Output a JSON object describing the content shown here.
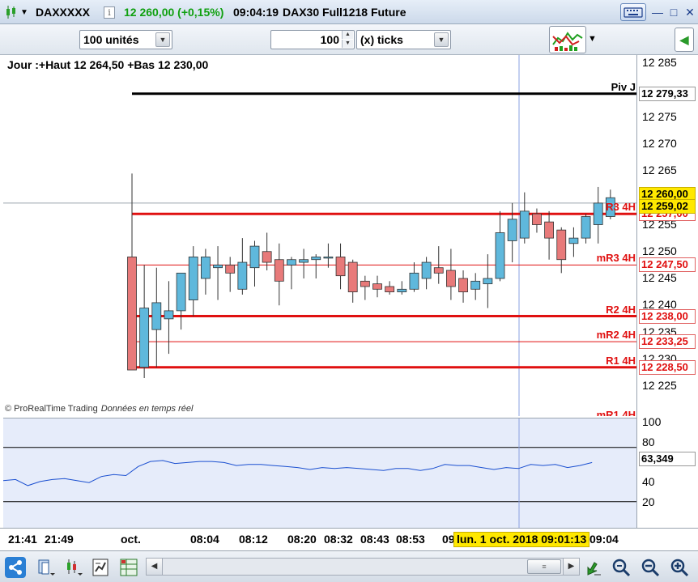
{
  "window": {
    "symbol": "DAXXXXX",
    "price_change": "12 260,00 (+0,15%)",
    "time": "09:04:19",
    "instrument": "DAX30 Full1218 Future",
    "info_icon": "info-icon",
    "keyboard_icon": "keyboard-icon",
    "minimize_icon": "minimize-icon",
    "maximize_icon": "maximize-icon",
    "close_icon": "close-icon"
  },
  "toolbar": {
    "units_select": "100 unités",
    "ticks_value": "100",
    "ticks_unit": "(x) ticks",
    "indicator_icon": "chart-indicators-icon"
  },
  "chart": {
    "header": "Jour :+Haut 12 264,50 +Bas 12 230,00",
    "copyright": "© ProRealTime Trading",
    "realtime": "Données en temps réel",
    "price_ticks": [
      "12 285",
      "12 275",
      "12 270",
      "12 265",
      "12 255",
      "12 250",
      "12 245",
      "12 240",
      "12 235",
      "12 230",
      "12 225"
    ],
    "levels": [
      {
        "name": "Piv J",
        "value": "12 279,33",
        "color": "#000000"
      },
      {
        "name": "R3 4H",
        "value": "12 257,00",
        "color": "#e01010"
      },
      {
        "name": "mR3 4H",
        "value": "12 247,50",
        "color": "#e01010"
      },
      {
        "name": "R2 4H",
        "value": "12 238,00",
        "color": "#e01010"
      },
      {
        "name": "mR2 4H",
        "value": "12 233,25",
        "color": "#e01010"
      },
      {
        "name": "R1 4H",
        "value": "12 228,50",
        "color": "#e01010"
      },
      {
        "name": "mR1 4H",
        "value": "",
        "color": "#e01010"
      }
    ],
    "last_price": "12 260,00",
    "cursor_price": "12 259,02",
    "cursor_time": "lun. 1 oct. 2018 09:01:13"
  },
  "chart_data": {
    "type": "candlestick",
    "candles": [
      {
        "o": 12249.0,
        "h": 12264.5,
        "l": 12230.0,
        "c": 12228.0
      },
      {
        "o": 12228.5,
        "h": 12247.5,
        "l": 12226.5,
        "c": 12239.5
      },
      {
        "o": 12235.5,
        "h": 12247.0,
        "l": 12228.5,
        "c": 12240.5
      },
      {
        "o": 12237.5,
        "h": 12244.5,
        "l": 12231.0,
        "c": 12239.0
      },
      {
        "o": 12239.0,
        "h": 12245.5,
        "l": 12235.5,
        "c": 12246.0
      },
      {
        "o": 12241.0,
        "h": 12251.0,
        "l": 12238.0,
        "c": 12249.0
      },
      {
        "o": 12245.0,
        "h": 12250.5,
        "l": 12242.0,
        "c": 12249.0
      },
      {
        "o": 12247.0,
        "h": 12251.0,
        "l": 12241.0,
        "c": 12247.5
      },
      {
        "o": 12247.5,
        "h": 12249.0,
        "l": 12242.5,
        "c": 12246.0
      },
      {
        "o": 12243.0,
        "h": 12252.5,
        "l": 12242.0,
        "c": 12248.0
      },
      {
        "o": 12247.0,
        "h": 12252.0,
        "l": 12243.5,
        "c": 12251.0
      },
      {
        "o": 12250.0,
        "h": 12253.5,
        "l": 12246.5,
        "c": 12248.0
      },
      {
        "o": 12248.5,
        "h": 12251.5,
        "l": 12240.0,
        "c": 12244.5
      },
      {
        "o": 12247.5,
        "h": 12249.0,
        "l": 12243.0,
        "c": 12248.5
      },
      {
        "o": 12248.0,
        "h": 12250.5,
        "l": 12245.0,
        "c": 12248.5
      },
      {
        "o": 12248.5,
        "h": 12249.5,
        "l": 12245.0,
        "c": 12249.0
      },
      {
        "o": 12249.0,
        "h": 12251.5,
        "l": 12247.0,
        "c": 12249.0
      },
      {
        "o": 12249.0,
        "h": 12251.5,
        "l": 12243.0,
        "c": 12245.5
      },
      {
        "o": 12248.0,
        "h": 12248.5,
        "l": 12240.5,
        "c": 12242.5
      },
      {
        "o": 12244.5,
        "h": 12245.5,
        "l": 12241.0,
        "c": 12243.5
      },
      {
        "o": 12244.0,
        "h": 12245.5,
        "l": 12241.5,
        "c": 12243.0
      },
      {
        "o": 12243.5,
        "h": 12244.5,
        "l": 12242.0,
        "c": 12242.5
      },
      {
        "o": 12242.5,
        "h": 12244.5,
        "l": 12242.0,
        "c": 12243.0
      },
      {
        "o": 12243.0,
        "h": 12248.0,
        "l": 12242.5,
        "c": 12246.0
      },
      {
        "o": 12245.0,
        "h": 12249.0,
        "l": 12243.0,
        "c": 12248.0
      },
      {
        "o": 12247.0,
        "h": 12251.0,
        "l": 12244.0,
        "c": 12246.0
      },
      {
        "o": 12246.5,
        "h": 12250.5,
        "l": 12241.0,
        "c": 12243.5
      },
      {
        "o": 12245.0,
        "h": 12246.5,
        "l": 12240.5,
        "c": 12242.5
      },
      {
        "o": 12243.0,
        "h": 12246.0,
        "l": 12241.0,
        "c": 12244.5
      },
      {
        "o": 12244.0,
        "h": 12249.5,
        "l": 12239.5,
        "c": 12245.0
      },
      {
        "o": 12245.0,
        "h": 12257.5,
        "l": 12244.5,
        "c": 12253.5
      },
      {
        "o": 12252.0,
        "h": 12259.0,
        "l": 12248.0,
        "c": 12256.0
      },
      {
        "o": 12252.5,
        "h": 12261.0,
        "l": 12251.5,
        "c": 12257.5
      },
      {
        "o": 12257.0,
        "h": 12258.0,
        "l": 12253.5,
        "c": 12255.0
      },
      {
        "o": 12255.5,
        "h": 12257.5,
        "l": 12248.5,
        "c": 12252.5
      },
      {
        "o": 12254.0,
        "h": 12254.5,
        "l": 12246.0,
        "c": 12248.5
      },
      {
        "o": 12251.5,
        "h": 12254.5,
        "l": 12249.0,
        "c": 12252.5
      },
      {
        "o": 12252.5,
        "h": 12257.0,
        "l": 12251.5,
        "c": 12256.5
      },
      {
        "o": 12255.0,
        "h": 12262.0,
        "l": 12251.5,
        "c": 12259.0
      },
      {
        "o": 12256.5,
        "h": 12261.5,
        "l": 12256.0,
        "c": 12260.0
      }
    ],
    "oscillator": {
      "ticks": [
        "100",
        "80",
        "40",
        "20"
      ],
      "current": "63,349",
      "upper": 70,
      "lower": 30,
      "values": [
        43,
        44,
        38,
        42,
        44,
        45,
        43,
        41,
        47,
        49,
        48,
        57,
        62,
        63,
        60,
        61,
        62,
        62,
        61,
        58,
        59,
        59,
        58,
        57,
        56,
        54,
        56,
        55,
        56,
        55,
        54,
        53,
        55,
        55,
        53,
        55,
        59,
        58,
        58,
        56,
        54,
        56,
        55,
        59,
        58,
        59,
        56,
        58,
        61
      ]
    }
  },
  "timeaxis": {
    "labels": [
      "21:41",
      "21:49",
      "oct.",
      "08:04",
      "08:12",
      "08:20",
      "08:32",
      "08:43",
      "08:53",
      "09",
      "09:04"
    ]
  },
  "bottombar": {
    "icons": [
      "share-icon",
      "layout-icon",
      "candles-icon",
      "indicator-icon",
      "grid-icon",
      "cursor-tool-icon",
      "zoom-auto-icon",
      "zoom-out-icon",
      "zoom-in-icon"
    ]
  }
}
